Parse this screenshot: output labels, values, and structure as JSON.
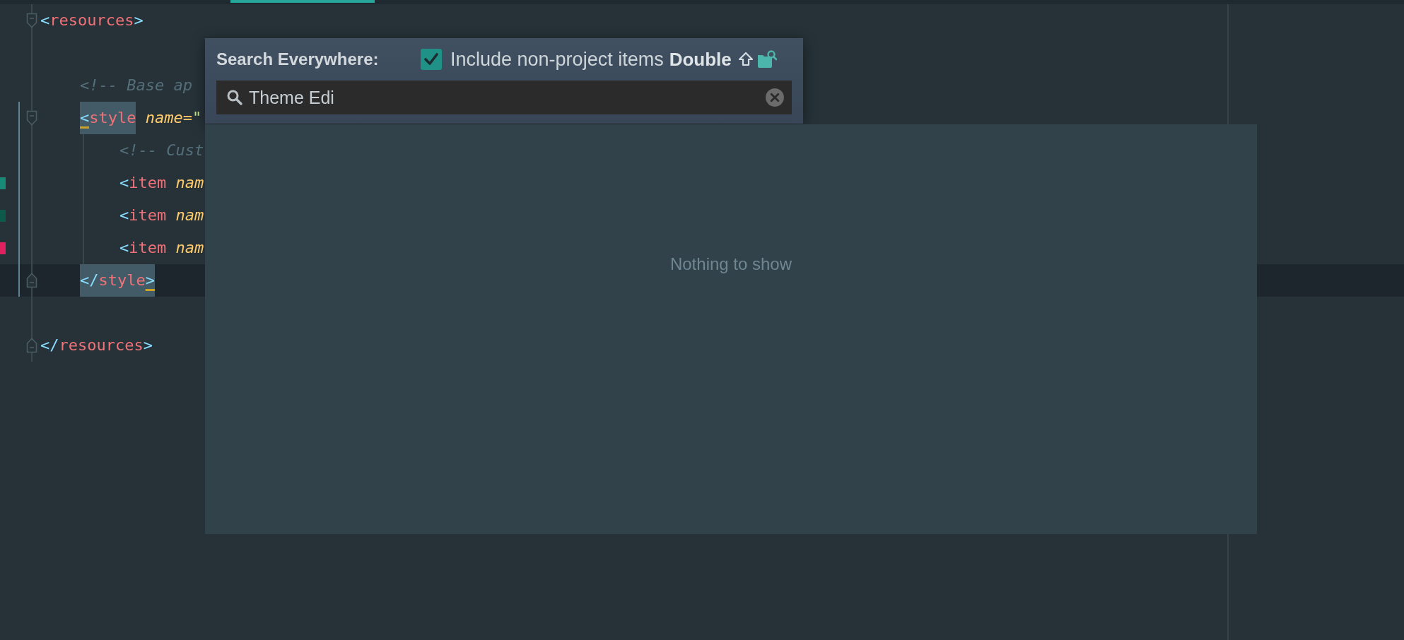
{
  "code_lines": [
    {
      "fold_start": true,
      "current": false,
      "tokens": [
        {
          "text": "<",
          "kind": "bracket",
          "matched": false,
          "underlined": false
        },
        {
          "text": "resources",
          "kind": "tag",
          "matched": false,
          "underlined": false
        },
        {
          "text": ">",
          "kind": "bracket",
          "matched": false,
          "underlined": false
        }
      ],
      "children": [
        {
          "current": false
        },
        {
          "current": false,
          "tokens": [
            {
              "text": "<!-- Base ap",
              "kind": "comment",
              "matched": false,
              "underlined": false
            }
          ]
        },
        {
          "fold_start": true,
          "current": false,
          "tokens": [
            {
              "text": "<",
              "kind": "bracket",
              "matched": true,
              "underlined": true
            },
            {
              "text": "style",
              "kind": "tag",
              "matched": true,
              "underlined": false
            },
            {
              "text": " name=",
              "kind": "attr",
              "matched": false,
              "underlined": false
            },
            {
              "text": "\"",
              "kind": "string",
              "matched": false,
              "underlined": false
            }
          ],
          "children": [
            {
              "current": false,
              "tokens": [
                {
                  "text": "<!-- Cust",
                  "kind": "comment",
                  "matched": false,
                  "underlined": false
                }
              ]
            },
            {
              "current": false,
              "color": "#1a8a78",
              "tokens": [
                {
                  "text": "<",
                  "kind": "bracket",
                  "matched": false,
                  "underlined": false
                },
                {
                  "text": "item",
                  "kind": "tag",
                  "matched": false,
                  "underlined": false
                },
                {
                  "text": " nam",
                  "kind": "attr",
                  "matched": false,
                  "underlined": false
                }
              ]
            },
            {
              "current": false,
              "color": "#0d5a4b",
              "tokens": [
                {
                  "text": "<",
                  "kind": "bracket",
                  "matched": false,
                  "underlined": false
                },
                {
                  "text": "item",
                  "kind": "tag",
                  "matched": false,
                  "underlined": false
                },
                {
                  "text": " nam",
                  "kind": "attr",
                  "matched": false,
                  "underlined": false
                }
              ]
            },
            {
              "current": false,
              "color": "#e0215f",
              "tokens": [
                {
                  "text": "<",
                  "kind": "bracket",
                  "matched": false,
                  "underlined": false
                },
                {
                  "text": "item",
                  "kind": "tag",
                  "matched": false,
                  "underlined": false
                },
                {
                  "text": " nam",
                  "kind": "attr",
                  "matched": false,
                  "underlined": false
                }
              ]
            }
          ]
        },
        {
          "fold_end": true,
          "current": true,
          "tokens": [
            {
              "text": "</",
              "kind": "bracket",
              "matched": true,
              "underlined": false
            },
            {
              "text": "style",
              "kind": "tag",
              "matched": true,
              "underlined": false
            },
            {
              "text": ">",
              "kind": "bracket",
              "matched": true,
              "underlined": true
            }
          ]
        }
      ]
    },
    {
      "current": false
    },
    {
      "fold_end": true,
      "current": false,
      "tokens": [
        {
          "text": "</",
          "kind": "bracket",
          "matched": false,
          "underlined": false
        },
        {
          "text": "resources",
          "kind": "tag",
          "matched": false,
          "underlined": false
        },
        {
          "text": ">",
          "kind": "bracket",
          "matched": false,
          "underlined": false
        }
      ]
    }
  ],
  "search_popup": {
    "title": "Search Everywhere:",
    "include_option": {
      "label": "Include non-project items",
      "checked": true,
      "shortcut": "Double"
    },
    "search": {
      "value": "Theme Edi"
    },
    "results": {
      "empty_text": "Nothing to show"
    }
  }
}
